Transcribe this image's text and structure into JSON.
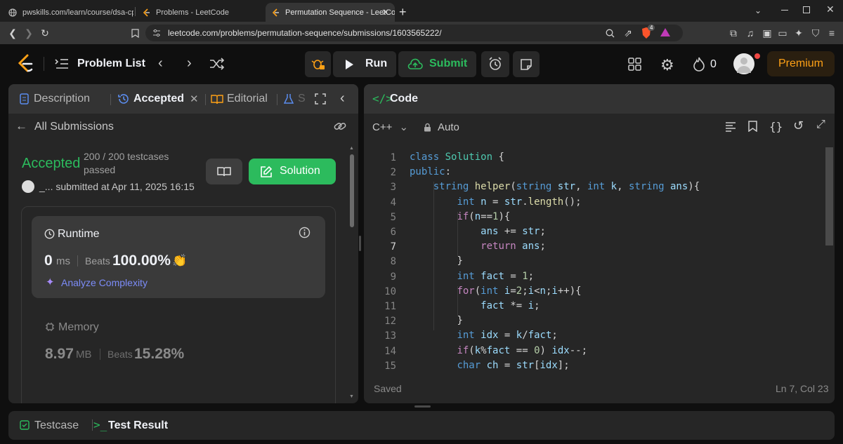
{
  "browser": {
    "tabs": [
      {
        "title": "pwskills.com/learn/course/dsa-cpp/"
      },
      {
        "title": "Problems - LeetCode"
      },
      {
        "title": "Permutation Sequence - LeetCo"
      }
    ],
    "new_tab": "+",
    "url": "leetcode.com/problems/permutation-sequence/submissions/1603565222/",
    "brave_badge": "4"
  },
  "nav": {
    "problem_list": "Problem List",
    "run": "Run",
    "submit": "Submit",
    "streak": "0",
    "premium": "Premium"
  },
  "left": {
    "tabs": {
      "description": "Description",
      "accepted": "Accepted",
      "editorial": "Editorial",
      "solutions": "S"
    },
    "back_label": "All Submissions",
    "status": "Accepted",
    "testcases": "200 / 200 testcases",
    "passed": "passed",
    "submitted": "_... submitted at Apr 11, 2025 16:15",
    "solution_btn": "Solution",
    "runtime": {
      "title": "Runtime",
      "value": "0",
      "unit": "ms",
      "beats_label": "Beats",
      "beats": "100.00%",
      "analyze": "Analyze Complexity"
    },
    "memory": {
      "title": "Memory",
      "value": "8.97",
      "unit": "MB",
      "beats_label": "Beats",
      "beats": "15.28%"
    }
  },
  "code": {
    "title": "Code",
    "language": "C++",
    "mode": "Auto",
    "status": "Saved",
    "cursor": "Ln 7, Col 23",
    "line_numbers": [
      "1",
      "2",
      "3",
      "4",
      "5",
      "6",
      "7",
      "8",
      "9",
      "10",
      "11",
      "12",
      "13",
      "14",
      "15"
    ],
    "lines": [
      "class Solution {",
      "public:",
      "    string helper(string str, int k, string ans){",
      "        int n = str.length();",
      "        if(n==1){",
      "            ans += str;",
      "            return ans;",
      "        }",
      "        int fact = 1;",
      "        for(int i=2;i<n;i++){",
      "            fact *= i;",
      "        }",
      "        int idx = k/fact;",
      "        if(k%fact == 0) idx--;",
      "        char ch = str[idx];"
    ]
  },
  "bottom": {
    "testcase": "Testcase",
    "test_result": "Test Result"
  },
  "colors": {
    "accent_green": "#2cbb5d",
    "premium_orange": "#ffa116",
    "analyze_purple": "#a78bfa"
  }
}
